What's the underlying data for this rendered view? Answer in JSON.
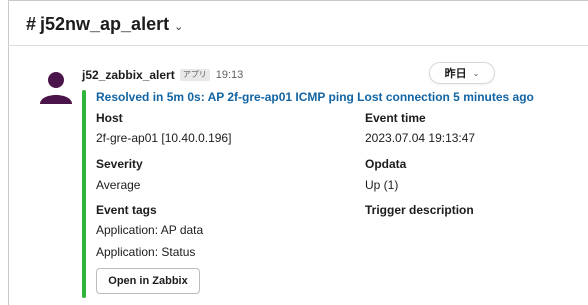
{
  "channel": {
    "hash": "#",
    "name": "j52nw_ap_alert",
    "chevron": "⌄"
  },
  "date_divider": {
    "label": "昨日",
    "chevron": "⌄"
  },
  "message": {
    "sender": "j52_zabbix_alert",
    "app_badge": "アプリ",
    "time": "19:13",
    "resolved_text": "Resolved in 5m 0s: AP 2f-gre-ap01 ICMP ping Lost connection 5 minutes ago",
    "fields": {
      "host_label": "Host",
      "host_value": "2f-gre-ap01 [10.40.0.196]",
      "event_time_label": "Event time",
      "event_time_value": "2023.07.04 19:13:47",
      "severity_label": "Severity",
      "severity_value": "Average",
      "opdata_label": "Opdata",
      "opdata_value": "Up (1)",
      "event_tags_label": "Event tags",
      "event_tags_values": [
        "Application: AP data",
        "Application: Status"
      ],
      "trigger_description_label": "Trigger description"
    },
    "button_label": "Open in Zabbix"
  },
  "colors": {
    "accent_green": "#2eb63c",
    "link_blue": "#1264a3",
    "avatar": "#4a154b"
  },
  "icons": {
    "avatar": "person-icon"
  }
}
